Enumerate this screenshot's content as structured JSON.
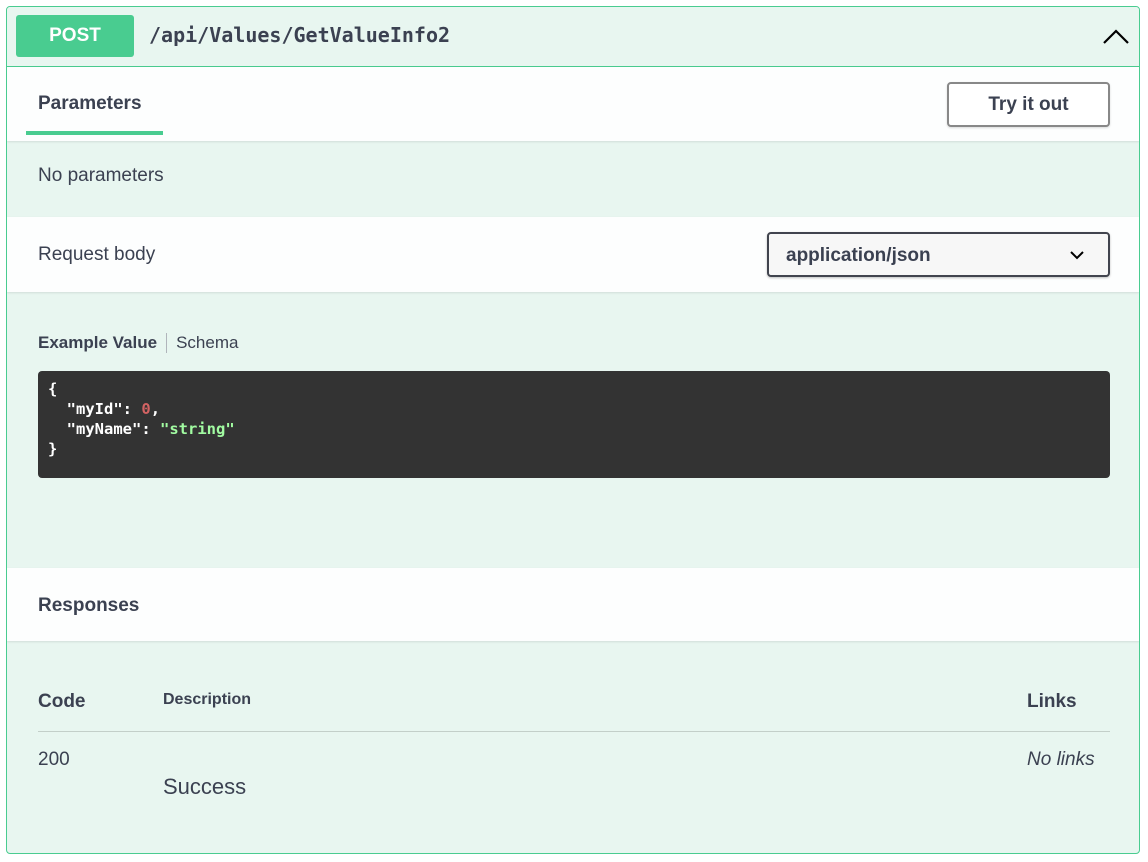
{
  "endpoint": {
    "method": "POST",
    "path": "/api/Values/GetValueInfo2",
    "colors": {
      "accent": "#49cc90",
      "background": "#e8f6f0"
    }
  },
  "parameters": {
    "tab_label": "Parameters",
    "try_button": "Try it out",
    "empty_text": "No parameters"
  },
  "request_body": {
    "label": "Request body",
    "content_type": "application/json",
    "tabs": {
      "example": "Example Value",
      "schema": "Schema"
    },
    "example": {
      "open": "{",
      "lines": [
        {
          "key": "\"myId\"",
          "value": "0",
          "suffix": ","
        },
        {
          "key": "\"myName\"",
          "value": "\"string\"",
          "suffix": ""
        }
      ],
      "close": "}"
    }
  },
  "responses": {
    "title": "Responses",
    "columns": {
      "code": "Code",
      "description": "Description",
      "links": "Links"
    },
    "rows": [
      {
        "code": "200",
        "description": "Success",
        "links": "No links"
      }
    ]
  }
}
